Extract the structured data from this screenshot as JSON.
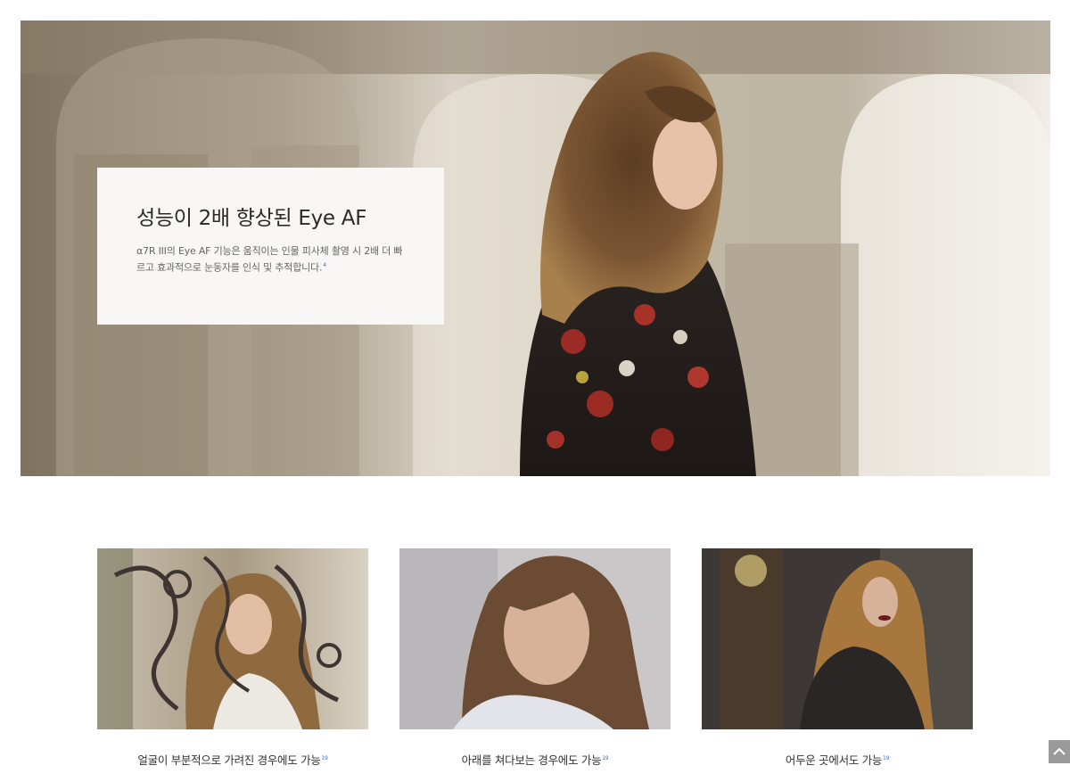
{
  "hero": {
    "title": "성능이 2배 향상된 Eye AF",
    "description": "α7R III의 Eye AF 기능은 움직이는 인물 피사체 촬영 시 2배 더 빠르고 효과적으로 눈동자를 인식 및 추적합니다.",
    "footnote": "4"
  },
  "features": [
    {
      "caption": "얼굴이 부분적으로 가려진 경우에도 가능",
      "footnote": "19"
    },
    {
      "caption": "아래를 쳐다보는 경우에도 가능",
      "footnote": "19"
    },
    {
      "caption": "어두운 곳에서도 가능",
      "footnote": "19"
    }
  ],
  "scroll_top": {
    "icon": "chevron-up-icon"
  },
  "colors": {
    "footnote": "#3c6fc0",
    "card_bg": "#f8f7f5",
    "top_button": "#9a9a9a"
  }
}
